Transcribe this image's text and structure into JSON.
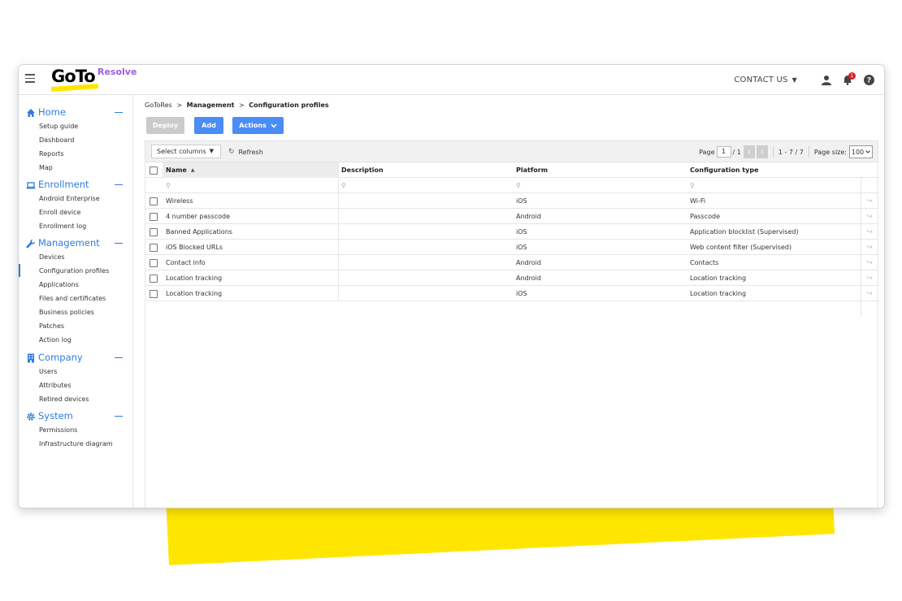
{
  "header": {
    "logo_main": "GoTo",
    "logo_sub": "Resolve",
    "contact_label": "CONTACT US",
    "notification_count": "1"
  },
  "sidebar": {
    "sections": [
      {
        "label": "Home",
        "icon": "home-icon",
        "items": [
          "Setup guide",
          "Dashboard",
          "Reports",
          "Map"
        ]
      },
      {
        "label": "Enrollment",
        "icon": "laptop-icon",
        "items": [
          "Android Enterprise",
          "Enroll device",
          "Enrollment log"
        ]
      },
      {
        "label": "Management",
        "icon": "wrench-icon",
        "items": [
          "Devices",
          "Configuration profiles",
          "Applications",
          "Files and certificates",
          "Business policies",
          "Patches",
          "Action log"
        ]
      },
      {
        "label": "Company",
        "icon": "building-icon",
        "items": [
          "Users",
          "Attributes",
          "Retired devices"
        ]
      },
      {
        "label": "System",
        "icon": "gear-icon",
        "items": [
          "Permissions",
          "Infrastructure diagram"
        ]
      }
    ],
    "active_item": "Configuration profiles"
  },
  "breadcrumb": {
    "root": "GoToRes",
    "sep": ">",
    "level1": "Management",
    "level2": "Configuration profiles"
  },
  "buttons": {
    "deploy": "Deploy",
    "add": "Add",
    "actions": "Actions"
  },
  "toolbar": {
    "select_columns": "Select columns",
    "refresh": "Refresh",
    "page_label": "Page",
    "page_current": "1",
    "page_total": "/ 1",
    "range": "1 - 7 / 7",
    "page_size_label": "Page size:",
    "page_size_value": "100"
  },
  "table": {
    "columns": [
      "Name",
      "Description",
      "Platform",
      "Configuration type"
    ],
    "sort_indicator": "▲",
    "rows": [
      {
        "name": "Wireless",
        "description": "",
        "platform": "iOS",
        "type": "Wi-Fi"
      },
      {
        "name": "4 number passcode",
        "description": "",
        "platform": "Android",
        "type": "Passcode"
      },
      {
        "name": "Banned Applications",
        "description": "",
        "platform": "iOS",
        "type": "Application blocklist (Supervised)"
      },
      {
        "name": "iOS Blocked URLs",
        "description": "",
        "platform": "iOS",
        "type": "Web content filter (Supervised)"
      },
      {
        "name": "Contact info",
        "description": "",
        "platform": "Android",
        "type": "Contacts"
      },
      {
        "name": "Location tracking",
        "description": "",
        "platform": "Android",
        "type": "Location tracking"
      },
      {
        "name": "Location tracking",
        "description": "",
        "platform": "iOS",
        "type": "Location tracking"
      }
    ]
  },
  "colors": {
    "accent": "#2f7be0",
    "button_blue": "#4b8cf5",
    "button_disabled": "#cbcbcb",
    "brand_yellow": "#ffe600",
    "brand_purple": "#9b5de5",
    "badge_red": "#e02020"
  }
}
